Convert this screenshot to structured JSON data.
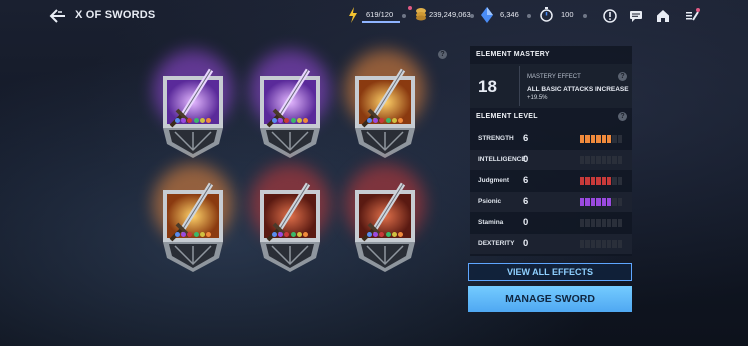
{
  "header": {
    "title": "X OF SWORDS",
    "energy": "619/120",
    "energy_fraction": 1.0,
    "gold": "239,249,063",
    "crystals": "6,346",
    "stamina": "100"
  },
  "icons": {
    "back": "back-arrow-icon",
    "energy": "lightning-icon",
    "gold": "coin-icon",
    "crystal": "crystal-icon",
    "stamina": "stopwatch-icon",
    "alert": "alert-icon",
    "chat": "chat-icon",
    "home": "home-icon",
    "quest": "quest-log-icon"
  },
  "help_mark": "?",
  "element_mastery": {
    "title": "ELEMENT MASTERY",
    "level": "18",
    "effect_label": "MASTERY EFFECT",
    "effect_desc": "ALL BASIC ATTACKS INCREASE",
    "effect_value": "+19.5%"
  },
  "element_level": {
    "title": "ELEMENT LEVEL",
    "max_level": 8,
    "rows": [
      {
        "name": "STRENGTH",
        "value": "6",
        "level": 6,
        "color": "#f08a3c"
      },
      {
        "name": "INTELLIGENCE",
        "value": "0",
        "level": 0,
        "color": "#4a7fe0"
      },
      {
        "name": "Judgment",
        "value": "6",
        "level": 6,
        "color": "#c83a3a"
      },
      {
        "name": "Psionic",
        "value": "6",
        "level": 6,
        "color": "#9a4ae0"
      },
      {
        "name": "Stamina",
        "value": "0",
        "level": 0,
        "color": "#3ab86a"
      },
      {
        "name": "DEXTERITY",
        "value": "0",
        "level": 0,
        "color": "#d0c040"
      }
    ]
  },
  "buttons": {
    "view_all": "VIEW ALL EFFECTS",
    "manage": "MANAGE SWORD"
  },
  "swords": [
    {
      "element": "psionic",
      "color": "#9a4ae0"
    },
    {
      "element": "psionic",
      "color": "#9a4ae0"
    },
    {
      "element": "strength",
      "color": "#f08a3c"
    },
    {
      "element": "strength",
      "color": "#f08a3c"
    },
    {
      "element": "judgment",
      "color": "#c83a3a"
    },
    {
      "element": "judgment",
      "color": "#c83a3a"
    }
  ]
}
